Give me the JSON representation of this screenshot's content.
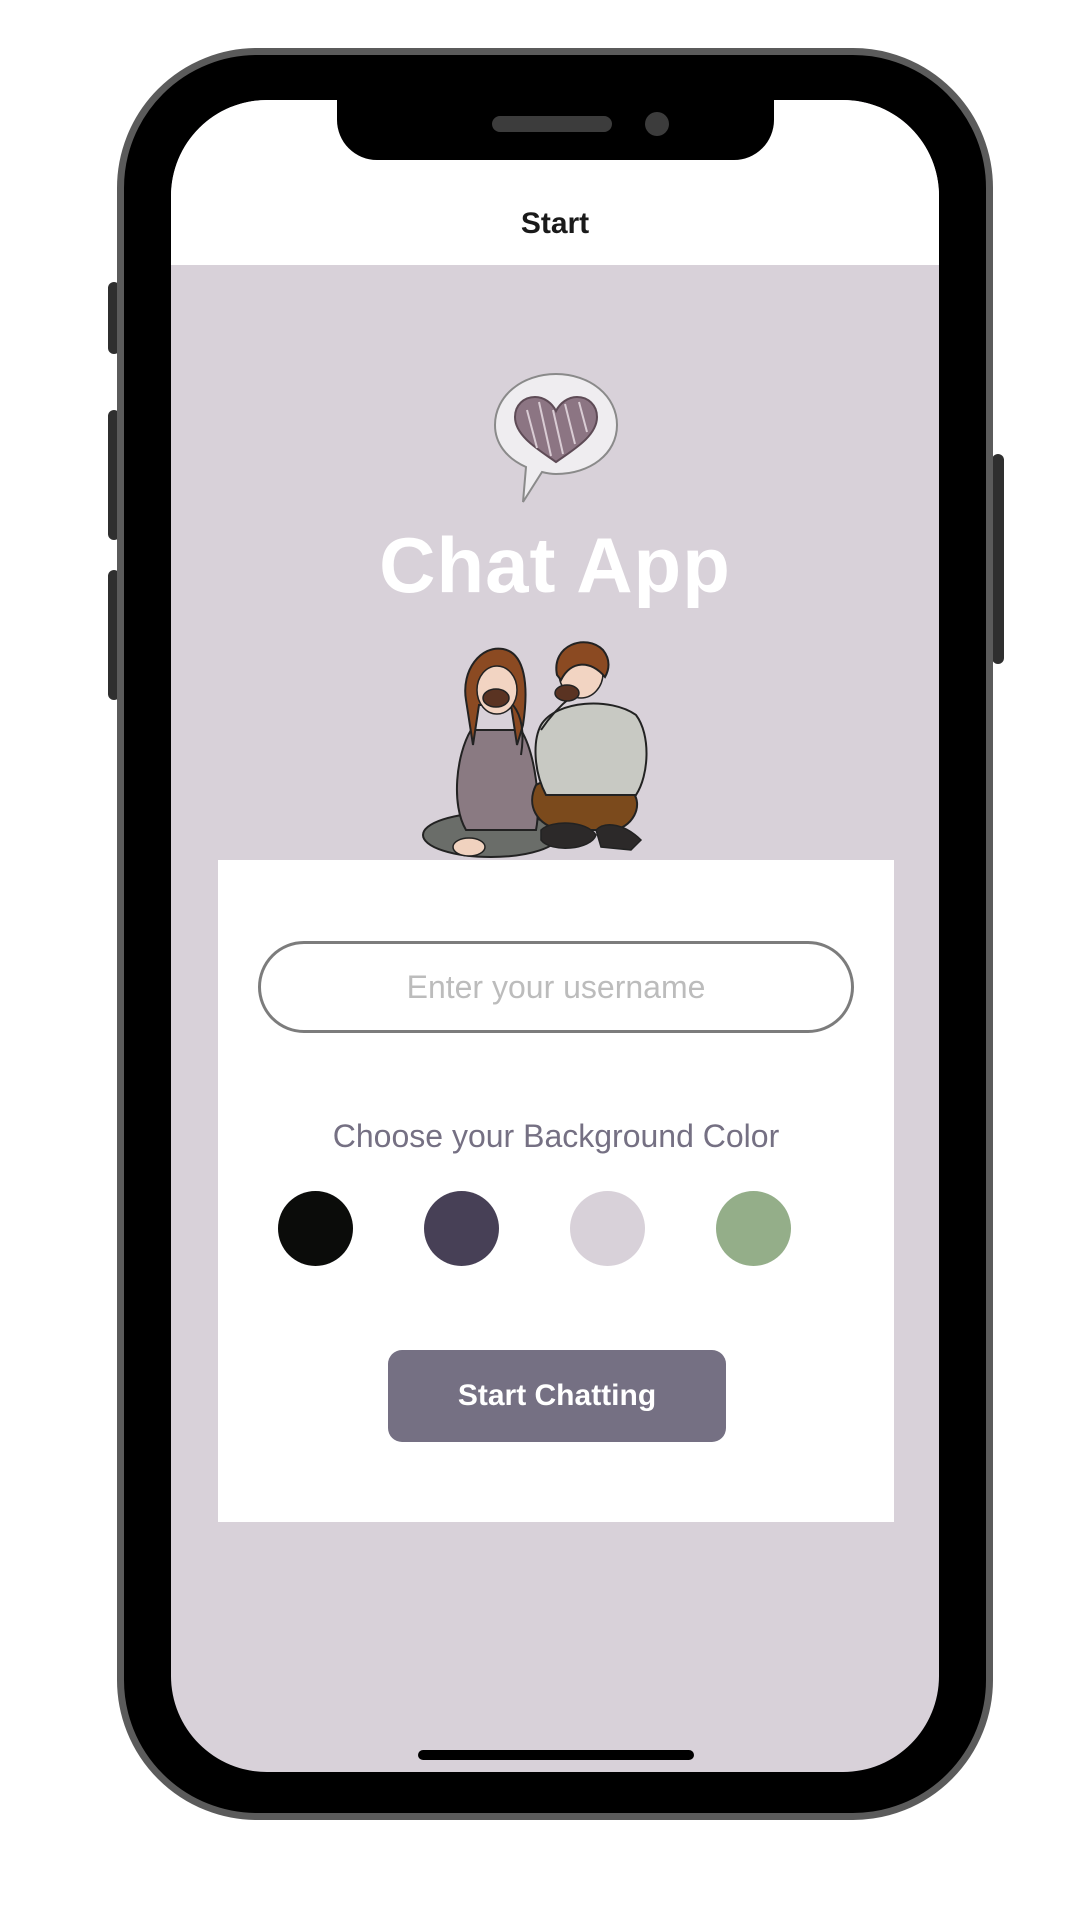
{
  "nav": {
    "title": "Start"
  },
  "hero": {
    "app_title": "Chat App",
    "logo_icon": "heart-chat-bubble-icon",
    "illustration": "couple-drinking-coffee-illustration"
  },
  "form": {
    "username_placeholder": "Enter your username",
    "username_value": "",
    "color_label": "Choose your Background Color",
    "swatches": [
      {
        "name": "black",
        "color": "#0b0c0a"
      },
      {
        "name": "purple",
        "color": "#474056"
      },
      {
        "name": "lavender",
        "color": "#d8d1d9"
      },
      {
        "name": "green",
        "color": "#94ae89"
      }
    ],
    "start_button": "Start Chatting"
  },
  "colors": {
    "background": "#d8d1d9",
    "accent": "#757083",
    "title": "#ffffff"
  }
}
